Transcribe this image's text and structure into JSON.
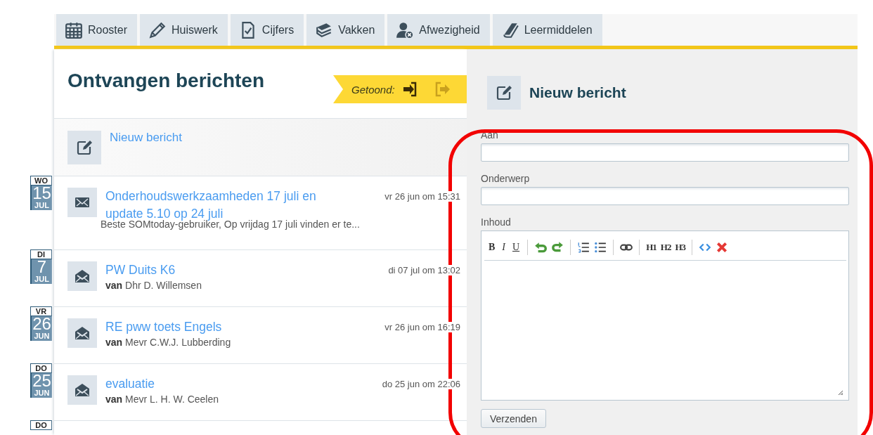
{
  "tabs": [
    {
      "label": "Rooster",
      "selected": false
    },
    {
      "label": "Huiswerk",
      "selected": false
    },
    {
      "label": "Cijfers",
      "selected": false
    },
    {
      "label": "Vakken",
      "selected": false
    },
    {
      "label": "Afwezigheid",
      "selected": false
    },
    {
      "label": "Leermiddelen",
      "selected": false
    }
  ],
  "inbox": {
    "title": "Ontvangen berichten",
    "shown_label": "Getoond:",
    "filters": [
      {
        "selected": true
      },
      {
        "selected": false
      }
    ],
    "new_message_link": "Nieuw bericht"
  },
  "messages": [
    {
      "day": "WO",
      "date": "15",
      "month": "JUL",
      "title": "Onderhoudswerkzaamheden 17 juli en update 5.10 op 24 juli",
      "time": "vr 26 jun om 15:31",
      "detail": "Beste SOMtoday-gebruiker, Op vrijdag 17 juli vinden er te...",
      "read": false
    },
    {
      "day": "DI",
      "date": "7",
      "month": "JUL",
      "title": "PW Duits K6",
      "time": "di 07 jul om 13:02",
      "detail": "**van** Dhr D. Willemsen",
      "read": true
    },
    {
      "day": "VR",
      "date": "26",
      "month": "JUN",
      "title": "RE pww toets Engels",
      "time": "vr 26 jun om 16:19",
      "detail": "**van** Mevr C.W.J. Lubberding",
      "read": true
    },
    {
      "day": "DO",
      "date": "25",
      "month": "JUN",
      "title": "evaluatie",
      "time": "do 25 jun om 22:06",
      "detail": "**van** Mevr L. H. W. Ceelen",
      "read": true
    }
  ],
  "next_date_badge": {
    "day": "DO"
  },
  "compose": {
    "title": "Nieuw bericht",
    "to_label": "Aan",
    "subject_label": "Onderwerp",
    "body_label": "Inhoud",
    "format_buttons": [
      "B",
      "I",
      "U"
    ],
    "heading_buttons": [
      "H1",
      "H2",
      "H3"
    ],
    "send_button": "Verzenden"
  }
}
